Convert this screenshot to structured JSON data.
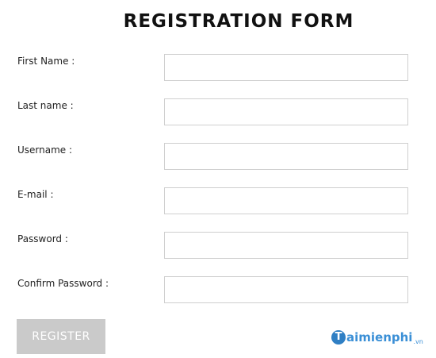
{
  "form": {
    "title": "REGISTRATION FORM",
    "fields": [
      {
        "label": "First Name :",
        "value": "",
        "placeholder": ""
      },
      {
        "label": "Last name :",
        "value": "",
        "placeholder": ""
      },
      {
        "label": "Username :",
        "value": "",
        "placeholder": ""
      },
      {
        "label": "E-mail :",
        "value": "",
        "placeholder": ""
      },
      {
        "label": "Password :",
        "value": "",
        "placeholder": ""
      },
      {
        "label": "Confirm Password :",
        "value": "",
        "placeholder": ""
      }
    ],
    "submit_label": "REGISTER"
  },
  "watermark": {
    "logo_letter": "T",
    "text": "aimienphi",
    "suffix": ".vn"
  },
  "colors": {
    "button_bg": "#cacaca",
    "input_border": "#cfcfcf",
    "watermark": "#3a8fd6"
  }
}
